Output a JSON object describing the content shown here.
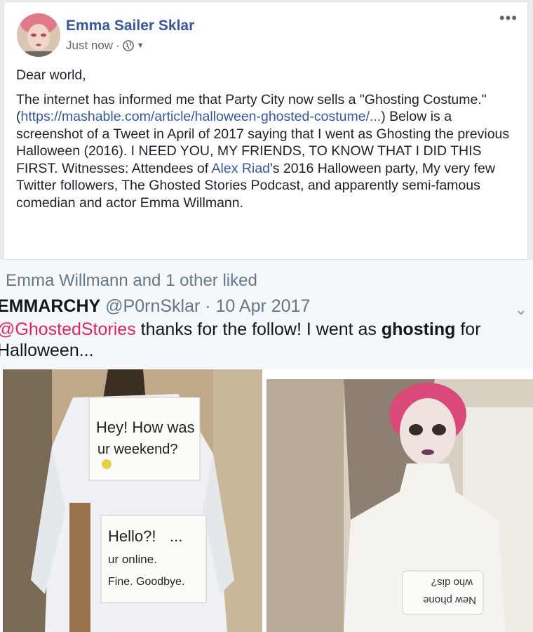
{
  "post": {
    "author": "Emma Sailer Sklar",
    "time": "Just now",
    "separator": "·",
    "paragraph1": "Dear world,",
    "paragraph2_a": "The internet has informed me that Party City now sells a \"Ghosting Costume.\" (",
    "link_text": "https://mashable.com/article/halloween-ghosted-costume/...",
    "paragraph2_b": ") Below is a screenshot of a Tweet in April of 2017 saying that I went as Ghosting the previous Halloween (2016). I NEED YOU, MY FRIENDS, TO KNOW THAT I DID THIS FIRST. Witnesses: Attendees of ",
    "tag_name": "Alex Riad",
    "paragraph2_c": "'s 2016 Halloween party, My very few Twitter followers, The Ghosted Stories Podcast, and apparently semi-famous comedian and actor Emma Willmann."
  },
  "tweet": {
    "liked_line": "Emma Willmann and 1 other liked",
    "name": "EMMARCHY",
    "handle_date": " @P0rnSklar · 10 Apr 2017",
    "mention": "@GhostedStories",
    "text_a": " thanks for the follow! I went as ",
    "text_bold": "ghosting",
    "text_b": " for Halloween..."
  },
  "sign1": {
    "line1": "Hey! How was",
    "line2": "ur weekend?"
  },
  "sign2": {
    "line1": "Hello?!",
    "dots": "...",
    "line2": "ur online.",
    "line3": "Fine. Goodbye."
  },
  "sign3": {
    "line1": "New phone",
    "line2": "who dis?"
  },
  "colors": {
    "link": "#385898",
    "mention": "#e0245e",
    "background": "#e9ebee"
  }
}
